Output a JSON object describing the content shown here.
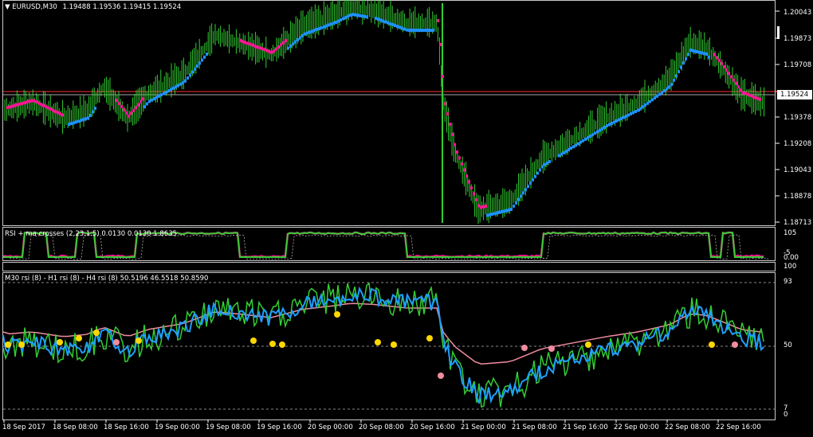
{
  "main_chart": {
    "symbol_label": "EURUSD,M30",
    "quote": "1.19488 1.19536 1.19415 1.19524",
    "current_price": "1.19524",
    "price_ticks": [
      "1.20043",
      "1.19873",
      "1.19708",
      "1.19378",
      "1.19208",
      "1.19043",
      "1.18878",
      "1.18713"
    ]
  },
  "rsi_pane": {
    "title": "RSI + ma crosses (2,23,1.5) 0.0130 0.0130 1.8635",
    "ticks": [
      "105",
      "-5",
      "0.00"
    ]
  },
  "empty_pane": {
    "ticks": [
      "100"
    ]
  },
  "mtf_pane": {
    "title": "M30 rsi (8) - H1 rsi (8) - H4 rsi (8) 50.5196 46.5518 50.8590",
    "ticks": [
      "93",
      "50",
      "7",
      "0"
    ]
  },
  "time_axis": [
    "18 Sep 2017",
    "18 Sep 08:00",
    "18 Sep 16:00",
    "19 Sep 00:00",
    "19 Sep 08:00",
    "19 Sep 16:00",
    "20 Sep 00:00",
    "20 Sep 08:00",
    "20 Sep 16:00",
    "21 Sep 00:00",
    "21 Sep 08:00",
    "21 Sep 16:00",
    "22 Sep 00:00",
    "22 Sep 08:00",
    "22 Sep 16:00"
  ],
  "colors": {
    "candle": "#32cd32",
    "trend_up": "#1e90ff",
    "trend_down": "#ff1493",
    "price_line": "#ff3030",
    "m30_line": "#32cd32",
    "h1_line": "#1e9fff",
    "h4_line": "#f08ca0",
    "cross_dot": "#ffd700"
  }
}
